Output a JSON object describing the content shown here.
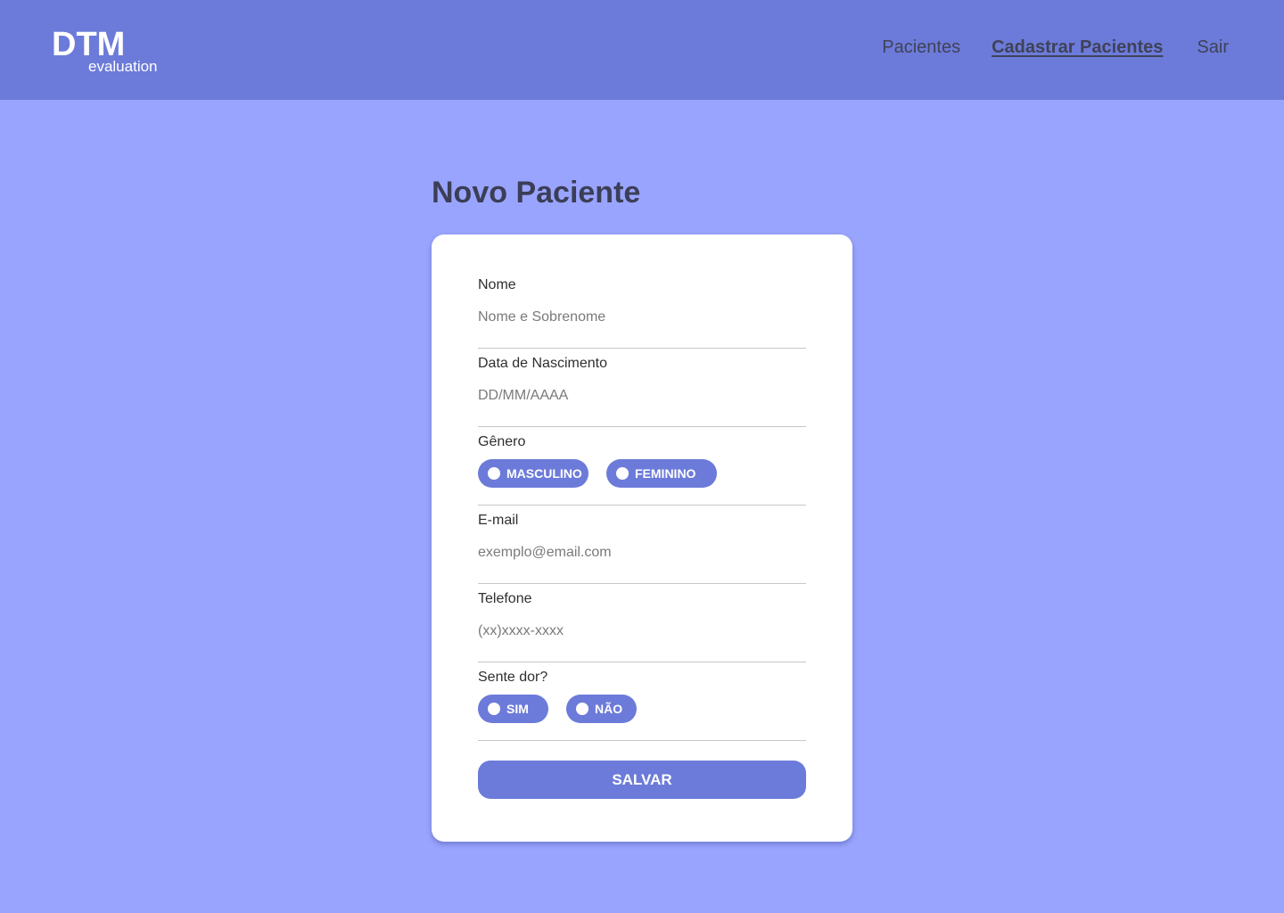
{
  "brand": {
    "title": "DTM",
    "subtitle": "evaluation"
  },
  "nav": {
    "items": [
      {
        "label": "Pacientes"
      },
      {
        "label": "Cadastrar Pacientes"
      },
      {
        "label": "Sair"
      }
    ]
  },
  "page": {
    "title": "Novo Paciente"
  },
  "form": {
    "name": {
      "label": "Nome",
      "placeholder": "Nome e Sobrenome"
    },
    "birthdate": {
      "label": "Data de Nascimento",
      "placeholder": "DD/MM/AAAA"
    },
    "gender": {
      "label": "Gênero",
      "options": [
        "MASCULINO",
        "FEMININO"
      ]
    },
    "email": {
      "label": "E-mail",
      "placeholder": "exemplo@email.com"
    },
    "phone": {
      "label": "Telefone",
      "placeholder": "(xx)xxxx-xxxx"
    },
    "pain": {
      "label": "Sente dor?",
      "options": [
        "SIM",
        "NÃO"
      ]
    },
    "save_label": "SALVAR"
  },
  "colors": {
    "background": "#99a4fe",
    "header": "#6c7bd9",
    "accent": "#6c7bd9",
    "card": "#ffffff"
  }
}
